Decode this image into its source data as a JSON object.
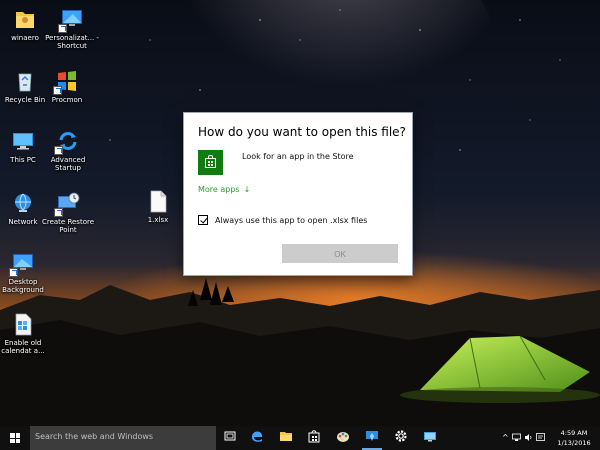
{
  "desktop": {
    "icons": [
      {
        "label": "winaero"
      },
      {
        "label": "Personalizat... - Shortcut"
      },
      {
        "label": "Recycle Bin"
      },
      {
        "label": "Procmon"
      },
      {
        "label": "This PC"
      },
      {
        "label": "Advanced Startup"
      },
      {
        "label": "Network"
      },
      {
        "label": "Create Restore Point"
      },
      {
        "label": "1.xlsx"
      },
      {
        "label": "Desktop Background"
      },
      {
        "label": "Enable old calendat a..."
      }
    ]
  },
  "dialog": {
    "title": "How do you want to open this file?",
    "store_option": "Look for an app in the Store",
    "more_apps": "More apps",
    "more_apps_arrow": "↓",
    "always_use": "Always use this app to open .xlsx files",
    "always_checked": true,
    "ok": "OK"
  },
  "taskbar": {
    "search_placeholder": "Search the web and Windows",
    "pinned": [
      "task-view-icon",
      "edge-icon",
      "file-explorer-icon",
      "store-icon",
      "paint-icon",
      "personalization-icon",
      "settings-icon",
      "remote-desktop-icon"
    ],
    "time": "4:59 AM",
    "date": "1/13/2016"
  },
  "colors": {
    "accent": "#107c10",
    "link": "#2e9c2e",
    "taskbar": "#101010",
    "tent": "#8fd63a"
  }
}
